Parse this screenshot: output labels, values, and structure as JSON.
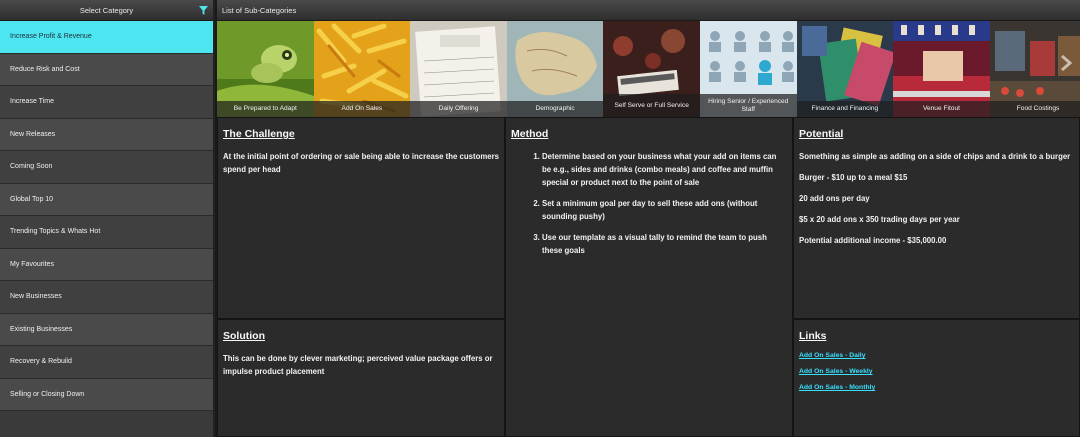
{
  "sidebar": {
    "header": "Select Category",
    "items": [
      {
        "label": "Increase Profit & Revenue",
        "active": true
      },
      {
        "label": "Reduce Risk and Cost"
      },
      {
        "label": "Increase Time"
      },
      {
        "label": "New Releases"
      },
      {
        "label": "Coming Soon"
      },
      {
        "label": "Global Top 10"
      },
      {
        "label": "Trending Topics & Whats Hot"
      },
      {
        "label": "My Favourites"
      },
      {
        "label": "New Businesses"
      },
      {
        "label": "Existing Businesses"
      },
      {
        "label": "Recovery & Rebuild"
      },
      {
        "label": "Selling or Closing Down"
      }
    ]
  },
  "main": {
    "header": "List of Sub-Categories",
    "subcategories": [
      "Be Prepared to Adapt",
      "Add On Sales",
      "Daily Offering",
      "Demographic",
      "Self Serve or Full Service",
      "Hiring Senior / Experienced Staff",
      "Finance and Financing",
      "Venue Fitout",
      "Food Costings"
    ],
    "challenge": {
      "title": "The Challenge",
      "text": "At the initial point of ordering or sale being able to increase the customers spend per head"
    },
    "method": {
      "title": "Method",
      "steps": [
        "Determine based on your business what your add on items can be e.g., sides and drinks (combo meals) and coffee and muffin special or product next to the point of sale",
        "Set a minimum goal per day to sell these add ons (without sounding pushy)",
        "Use our template as a visual tally to remind the team to push these goals"
      ]
    },
    "potential": {
      "title": "Potential",
      "lines": [
        "Something as simple as adding on a side of chips and a drink to a burger",
        "Burger - $10 up to a meal $15",
        "20 add ons per day",
        "$5 x 20 add ons x 350 trading days per year",
        "Potential additional income - $35,000.00"
      ]
    },
    "solution": {
      "title": "Solution",
      "text": "This can be done by clever marketing; perceived value package offers or impulse product placement"
    },
    "links": {
      "title": "Links",
      "items": [
        "Add On Sales - Daily",
        "Add On Sales - Weekly",
        "Add On Sales - Monthly"
      ]
    }
  },
  "colors": {
    "accent": "#4de6f0",
    "link": "#38e0ff"
  }
}
